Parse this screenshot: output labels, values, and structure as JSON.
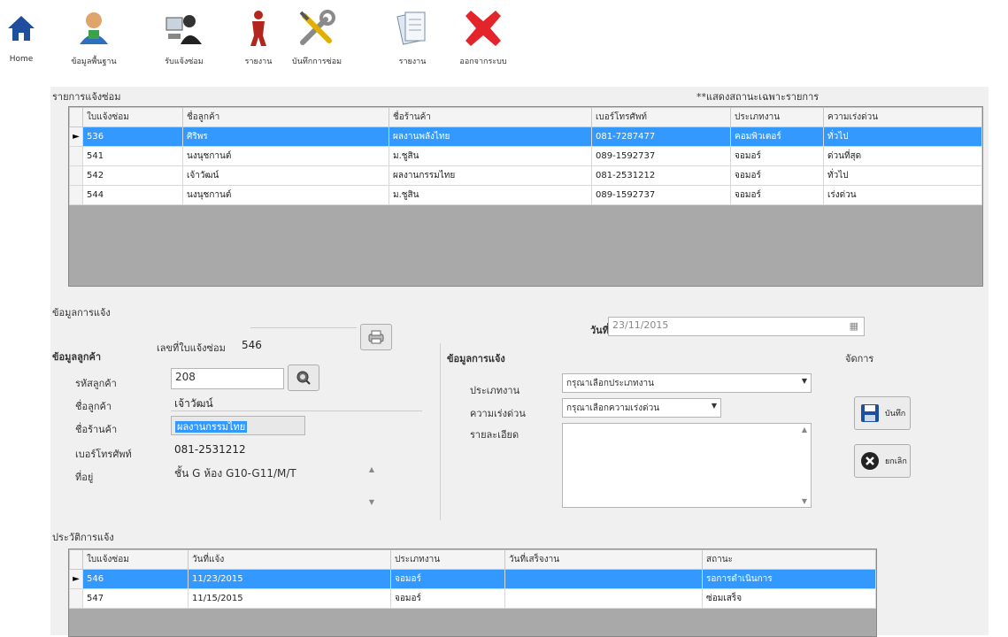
{
  "toolbar": {
    "items": [
      {
        "label": "Home",
        "icon": "home-icon"
      },
      {
        "label": "ข้อมูลพื้นฐาน",
        "icon": "user-icon"
      },
      {
        "label": "รับแจ้งซ่อม",
        "icon": "repair-request-icon"
      },
      {
        "label": "รายงาน",
        "icon": "tools-figure-icon"
      },
      {
        "label": "บันทึกการซ่อม",
        "icon": "wrench-screwdriver-icon"
      },
      {
        "label": "รายงาน",
        "icon": "document-icon"
      },
      {
        "label": "ออกจากระบบ",
        "icon": "exit-icon"
      }
    ]
  },
  "repair_list": {
    "title": "รายการแจ้งซ่อม",
    "note": "**แสดงสถานะเฉพาะรายการ",
    "columns": [
      "ใบแจ้งซ่อม",
      "ชื่อลูกค้า",
      "ชื่อร้านค้า",
      "เบอร์โทรศัพท์",
      "ประเภทงาน",
      "ความเร่งด่วน"
    ],
    "rows": [
      [
        "536",
        "ศิริพร",
        "ผลงานพลังไทย",
        "081-7287477",
        "คอมพิวเตอร์",
        "ทั่วไป"
      ],
      [
        "541",
        "นงนุชกานต์",
        "ม.ชูสิน",
        "089-1592737",
        "จอมอร์",
        "ด่วนที่สุด"
      ],
      [
        "542",
        "เจ้าวัฒน์",
        "ผลงานกรรมไทย",
        "081-2531212",
        "จอมอร์",
        "ทั่วไป"
      ],
      [
        "544",
        "นงนุชกานต์",
        "ม.ชูสิน",
        "089-1592737",
        "จอมอร์",
        "เร่งด่วน"
      ]
    ],
    "selected_index": 0
  },
  "details": {
    "section_title": "ข้อมูลการแจ้ง",
    "ticket_label": "เลขที่ใบแจ้งซ่อม",
    "ticket_number": "546",
    "date_label": "วันที่",
    "date_value": "23/11/2015",
    "customer_group": "ข้อมูลลูกค้า",
    "customer_id_label": "รหัสลูกค้า",
    "customer_id": "208",
    "customer_name_label": "ชื่อลูกค้า",
    "customer_name": "เจ้าวัฒน์",
    "shop_label": "ชื่อร้านค้า",
    "shop_value": "ผลงานกรรมไทย",
    "phone_label": "เบอร์โทรศัพท์",
    "phone_value": "081-2531212",
    "address_label": "ที่อยู่",
    "address_value": "ชั้น G ห้อง G10-G11/M/T",
    "request_group": "ข้อมูลการแจ้ง",
    "type_label": "ประเภทงาน",
    "type_value": "กรุณาเลือกประเภทงาน",
    "urgency_label": "ความเร่งด่วน",
    "urgency_value": "กรุณาเลือกความเร่งด่วน",
    "detail_label": "รายละเอียด",
    "actions_label": "จัดการ",
    "save_label": "บันทึก",
    "cancel_label": "ยกเลิก"
  },
  "history": {
    "title": "ประวัติการแจ้ง",
    "columns": [
      "ใบแจ้งซ่อม",
      "วันที่แจ้ง",
      "ประเภทงาน",
      "วันที่เสร็จงาน",
      "สถานะ"
    ],
    "rows": [
      [
        "546",
        "11/23/2015",
        "จอมอร์",
        "",
        "รอการดำเนินการ"
      ],
      [
        "547",
        "11/15/2015",
        "จอมอร์",
        "",
        "ซ่อมเสร็จ"
      ]
    ],
    "selected_index": 0
  },
  "colors": {
    "selection": "#3399ff",
    "grid_bg": "#a9a9a9",
    "exit_red": "#e3242b",
    "home_blue": "#1f4e9e"
  }
}
